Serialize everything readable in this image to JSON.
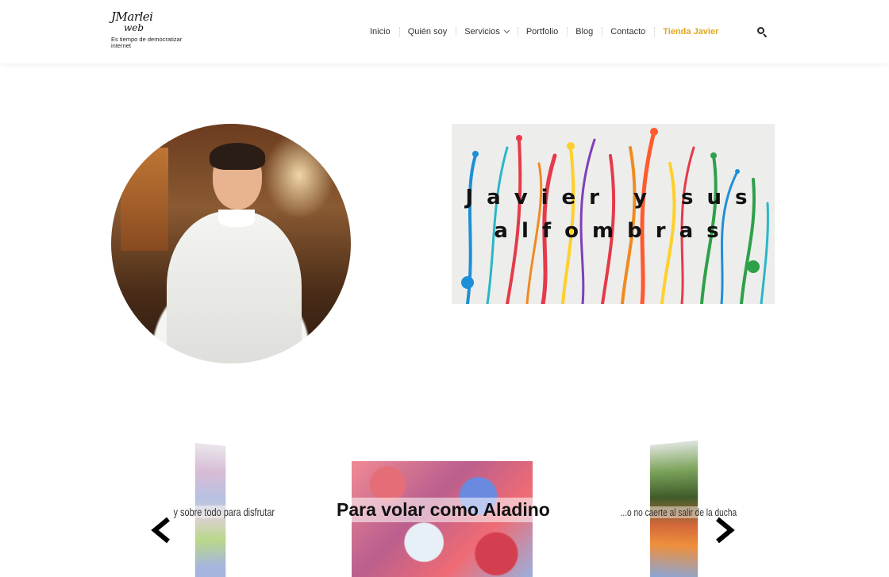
{
  "logo": {
    "script_line1": "JMarlei",
    "script_line2": "web",
    "tagline": "Es tiempo de democratizar internet"
  },
  "nav": {
    "items": [
      {
        "label": "Inicio"
      },
      {
        "label": "Quién soy"
      },
      {
        "label": "Servicios",
        "has_dropdown": true
      },
      {
        "label": "Portfolio"
      },
      {
        "label": "Blog"
      },
      {
        "label": "Contacto"
      },
      {
        "label": "Tienda Javier",
        "active": true
      }
    ],
    "search_icon": "search-icon",
    "active_color": "#e2a71f"
  },
  "hero": {
    "banner_title_line1": "Javier y sus",
    "banner_title_line2": "alfombras"
  },
  "carousel": {
    "captions": {
      "left": "y sobre todo para disfrutar",
      "center": "Para volar como Aladino",
      "right": "...o no caerte al salir de la ducha"
    },
    "prev_icon": "chevron-left-icon",
    "next_icon": "chevron-right-icon"
  }
}
